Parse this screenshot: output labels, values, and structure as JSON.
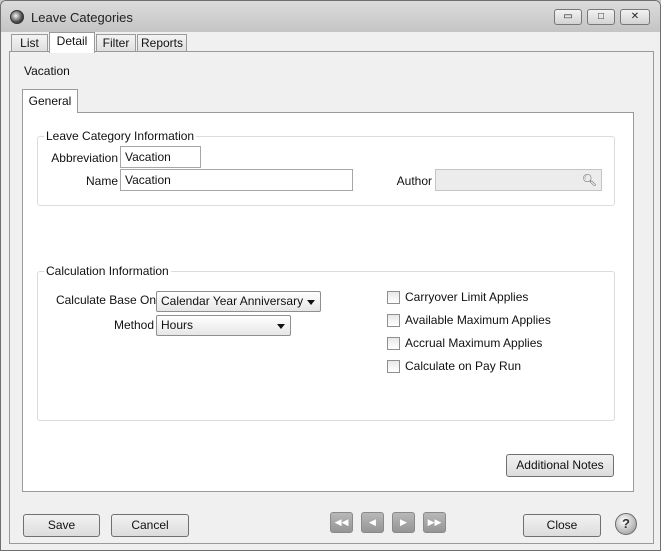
{
  "window": {
    "title": "Leave Categories",
    "controls": {
      "minimize": "▭",
      "maximize": "□",
      "close": "✕"
    }
  },
  "tabs": [
    {
      "label": "List"
    },
    {
      "label": "Detail"
    },
    {
      "label": "Filter"
    },
    {
      "label": "Reports"
    }
  ],
  "record_title": "Vacation",
  "subtabs": [
    {
      "label": "General"
    }
  ],
  "leave_info": {
    "title": "Leave Category Information",
    "abbreviation_label": "Abbreviation",
    "abbreviation_value": "Vacation",
    "name_label": "Name",
    "name_value": "Vacation",
    "author_label": "Author",
    "author_value": "",
    "author_icon": "search-icon"
  },
  "calc_info": {
    "title": "Calculation Information",
    "base_label": "Calculate Base On",
    "base_value": "Calendar Year Anniversary",
    "method_label": "Method",
    "method_value": "Hours",
    "checkboxes": [
      {
        "label": "Carryover Limit Applies",
        "checked": false
      },
      {
        "label": "Available Maximum Applies",
        "checked": false
      },
      {
        "label": "Accrual Maximum Applies",
        "checked": false
      },
      {
        "label": "Calculate on Pay Run",
        "checked": false
      }
    ]
  },
  "additional_notes_label": "Additional Notes",
  "footer": {
    "save_label": "Save",
    "cancel_label": "Cancel",
    "close_label": "Close",
    "help_label": "?",
    "nav": {
      "first": "◀◀",
      "prev": "◀",
      "next": "▶",
      "last": "▶▶"
    }
  }
}
